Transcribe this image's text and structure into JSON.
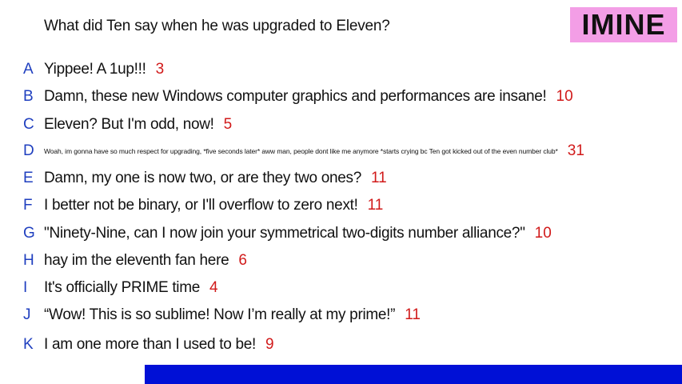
{
  "question": "What did Ten say when he was upgraded to Eleven?",
  "logo": "IMINE",
  "colors": {
    "letter": "#1f3fbf",
    "votes": "#d11a1a",
    "logo_bg": "#f39ee6",
    "bottom_bar": "#0010d6"
  },
  "answers": [
    {
      "letter": "A",
      "text": "Yippee! A 1up!!!",
      "votes": "3"
    },
    {
      "letter": "B",
      "text": "Damn, these new Windows computer graphics and performances are insane!",
      "votes": "10"
    },
    {
      "letter": "C",
      "text": "Eleven? But I'm odd, now!",
      "votes": "5"
    },
    {
      "letter": "D",
      "text": "Woah, im gonna have so much respect for upgrading, *five seconds later* aww man, people dont like me anymore *starts crying bc Ten got kicked out of the even number club*",
      "votes": "31"
    },
    {
      "letter": "E",
      "text": "Damn, my one is now two, or are they two ones?",
      "votes": "11"
    },
    {
      "letter": "F",
      "text": "I better not be binary, or I'll overflow to zero next!",
      "votes": "11"
    },
    {
      "letter": "G",
      "text": "\"Ninety-Nine, can I now join your symmetrical two-digits number alliance?\"",
      "votes": "10"
    },
    {
      "letter": "H",
      "text": "hay im the eleventh fan here",
      "votes": "6"
    },
    {
      "letter": "I",
      "text": "It's officially PRIME time",
      "votes": "4"
    },
    {
      "letter": "J",
      "text": "“Wow! This is so sublime! Now I’m really at my prime!”",
      "votes": "11"
    },
    {
      "letter": "K",
      "text": "I am one more than I used to be!",
      "votes": "9"
    }
  ]
}
